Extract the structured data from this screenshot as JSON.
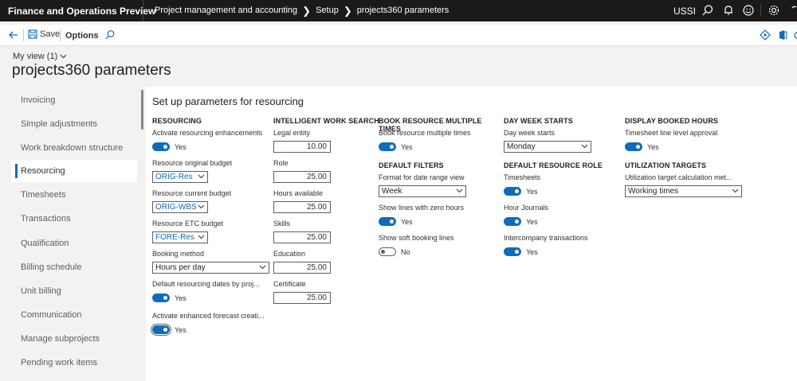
{
  "topbar": {
    "app_title": "Finance and Operations Preview",
    "breadcrumbs": [
      "Project management and accounting",
      "Setup",
      "projects360 parameters"
    ],
    "company": "USSI"
  },
  "actionbar": {
    "save_label": "Save",
    "options_label": "Options"
  },
  "myview": "My view (1)",
  "page_title": "projects360 parameters",
  "nav": {
    "items": [
      "Invoicing",
      "Simple adjustments",
      "Work breakdown structure",
      "Resourcing",
      "Timesheets",
      "Transactions",
      "Qualification",
      "Billing schedule",
      "Unit billing",
      "Communication",
      "Manage subprojects",
      "Pending work items"
    ],
    "active": "Resourcing"
  },
  "panel_title": "Set up parameters for resourcing",
  "resourcing": {
    "header": "RESOURCING",
    "activate_label": "Activate resourcing enhancements",
    "activate_value": "Yes",
    "original_budget_label": "Resource original budget",
    "original_budget_value": "ORIG-Res",
    "current_budget_label": "Resource current budget",
    "current_budget_value": "ORIG-WBS",
    "etc_budget_label": "Resource ETC budget",
    "etc_budget_value": "FORE-Res",
    "booking_method_label": "Booking method",
    "booking_method_value": "Hours per day",
    "default_dates_label": "Default resourcing dates by proj...",
    "default_dates_value": "Yes",
    "enhanced_forecast_label": "Activate enhanced forecast creati...",
    "enhanced_forecast_value": "Yes"
  },
  "work_search": {
    "header": "INTELLIGENT WORK SEARCH",
    "fields": [
      {
        "label": "Legal entity",
        "value": "10.00"
      },
      {
        "label": "Role",
        "value": "25.00"
      },
      {
        "label": "Hours available",
        "value": "25.00"
      },
      {
        "label": "Skills",
        "value": "25.00"
      },
      {
        "label": "Education",
        "value": "25.00"
      },
      {
        "label": "Certificate",
        "value": "25.00"
      }
    ]
  },
  "book_multiple": {
    "header": "BOOK RESOURCE MULTIPLE TIMES",
    "label": "Book resource multiple times",
    "value": "Yes"
  },
  "default_filters": {
    "header": "DEFAULT FILTERS",
    "format_label": "Format for date range view",
    "format_value": "Week",
    "zero_hours_label": "Show lines with zero hours",
    "zero_hours_value": "Yes",
    "soft_booking_label": "Show soft booking lines",
    "soft_booking_value": "No"
  },
  "day_week": {
    "header": "DAY WEEK STARTS",
    "label": "Day week starts",
    "value": "Monday"
  },
  "default_role": {
    "header": "DEFAULT RESOURCE ROLE",
    "timesheets_label": "Timesheets",
    "timesheets_value": "Yes",
    "hour_journals_label": "Hour Journals",
    "hour_journals_value": "Yes",
    "intercompany_label": "Intercompany transactions",
    "intercompany_value": "Yes"
  },
  "booked_hours": {
    "header": "DISPLAY BOOKED HOURS",
    "label": "Timesheet line level approval",
    "value": "Yes"
  },
  "utilization": {
    "header": "UTILIZATION TARGETS",
    "label": "Utilization target calculation met...",
    "value": "Working times"
  },
  "colors": {
    "accent": "#0f6cbd",
    "topbar": "#1b1a19"
  }
}
